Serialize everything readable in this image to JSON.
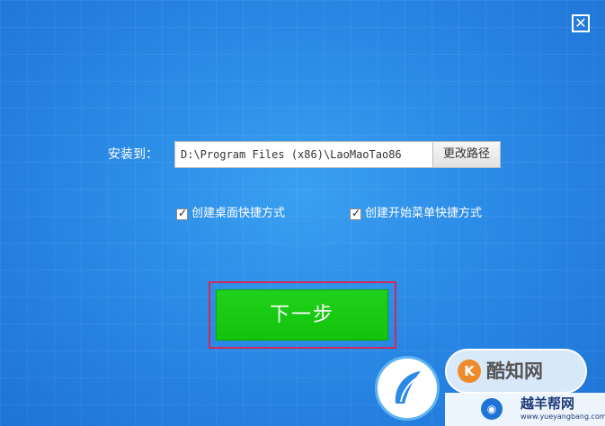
{
  "window": {
    "close_glyph": "✕"
  },
  "install": {
    "label": "安装到：",
    "path_value": "D:\\Program Files (x86)\\LaoMaoTao86",
    "change_path_label": "更改路径"
  },
  "options": [
    {
      "label": "创建桌面快捷方式",
      "checked": true
    },
    {
      "label": "创建开始菜单快捷方式",
      "checked": true
    }
  ],
  "next_button": {
    "label": "下一步"
  },
  "watermark": {
    "badge_text": "酷知网",
    "strip_title": "越羊帮网",
    "strip_sub": "www.yueyangbang.com"
  },
  "colors": {
    "background": "#2a8ae6",
    "next_button": "#13c30c",
    "highlight_outline": "#d2295a"
  }
}
